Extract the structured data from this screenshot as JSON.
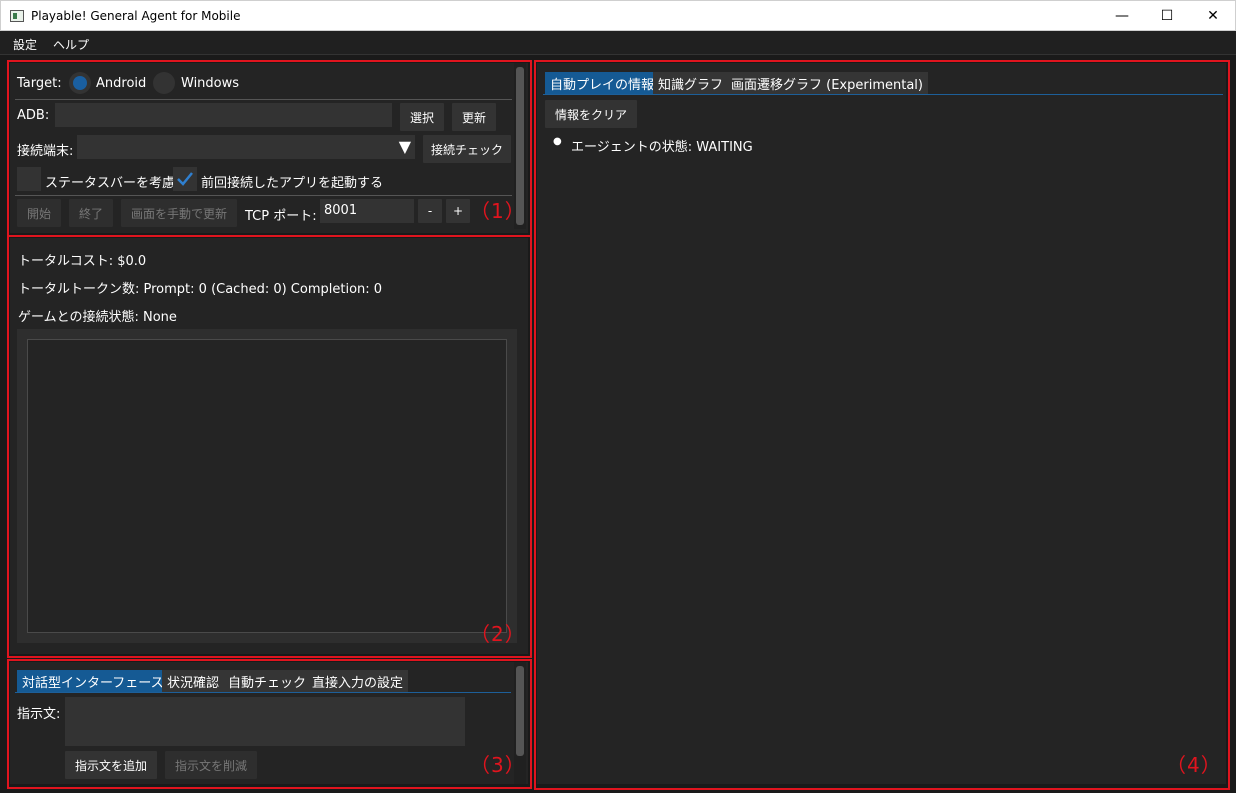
{
  "window": {
    "title": "Playable! General Agent for Mobile",
    "minimize": "—",
    "maximize": "☐",
    "close": "✕"
  },
  "menu": {
    "settings": "設定",
    "help": "ヘルプ"
  },
  "connection": {
    "target_label": "Target:",
    "android_label": "Android",
    "windows_label": "Windows",
    "selected_target": "Android",
    "adb_label": "ADB:",
    "adb_value": "",
    "select_button": "選択",
    "refresh_button": "更新",
    "device_label": "接続端末:",
    "device_value": "",
    "connection_check_button": "接続チェック",
    "statusbar_label": "ステータスバーを考慮",
    "statusbar_checked": false,
    "launch_last_app_label": "前回接続したアプリを起動する",
    "launch_last_app_checked": true,
    "start_button": "開始",
    "stop_button": "終了",
    "manual_refresh_button": "画面を手動で更新",
    "tcp_port_label": "TCP ポート:",
    "tcp_port_value": "8001",
    "minus_button": "-",
    "plus_button": "+"
  },
  "status": {
    "total_cost": "トータルコスト: $0.0",
    "total_tokens": "トータルトークン数:  Prompt: 0 (Cached: 0) Completion: 0",
    "game_connection": "ゲームとの接続状態:  None"
  },
  "bottom_tabs": {
    "tabs": [
      "対話型インターフェース",
      "状況確認",
      "自動チェック",
      "直接入力の設定"
    ],
    "active_index": 0,
    "instruction_label": "指示文:",
    "instruction_value": "",
    "add_button": "指示文を追加",
    "remove_button": "指示文を削減"
  },
  "right_tabs": {
    "tabs": [
      "自動プレイの情報",
      "知識グラフ",
      "画面遷移グラフ (Experimental)"
    ],
    "active_index": 0,
    "clear_button": "情報をクリア",
    "bullet": "●",
    "agent_state": "エージェントの状態: WAITING"
  },
  "markers": {
    "m1": "（1）",
    "m2": "（2）",
    "m3": "（3）",
    "m4": "（4）"
  },
  "colors": {
    "accent": "#155a94",
    "annotation_red": "#e0141e",
    "panel_bg": "#242424",
    "control_bg": "#333333"
  }
}
